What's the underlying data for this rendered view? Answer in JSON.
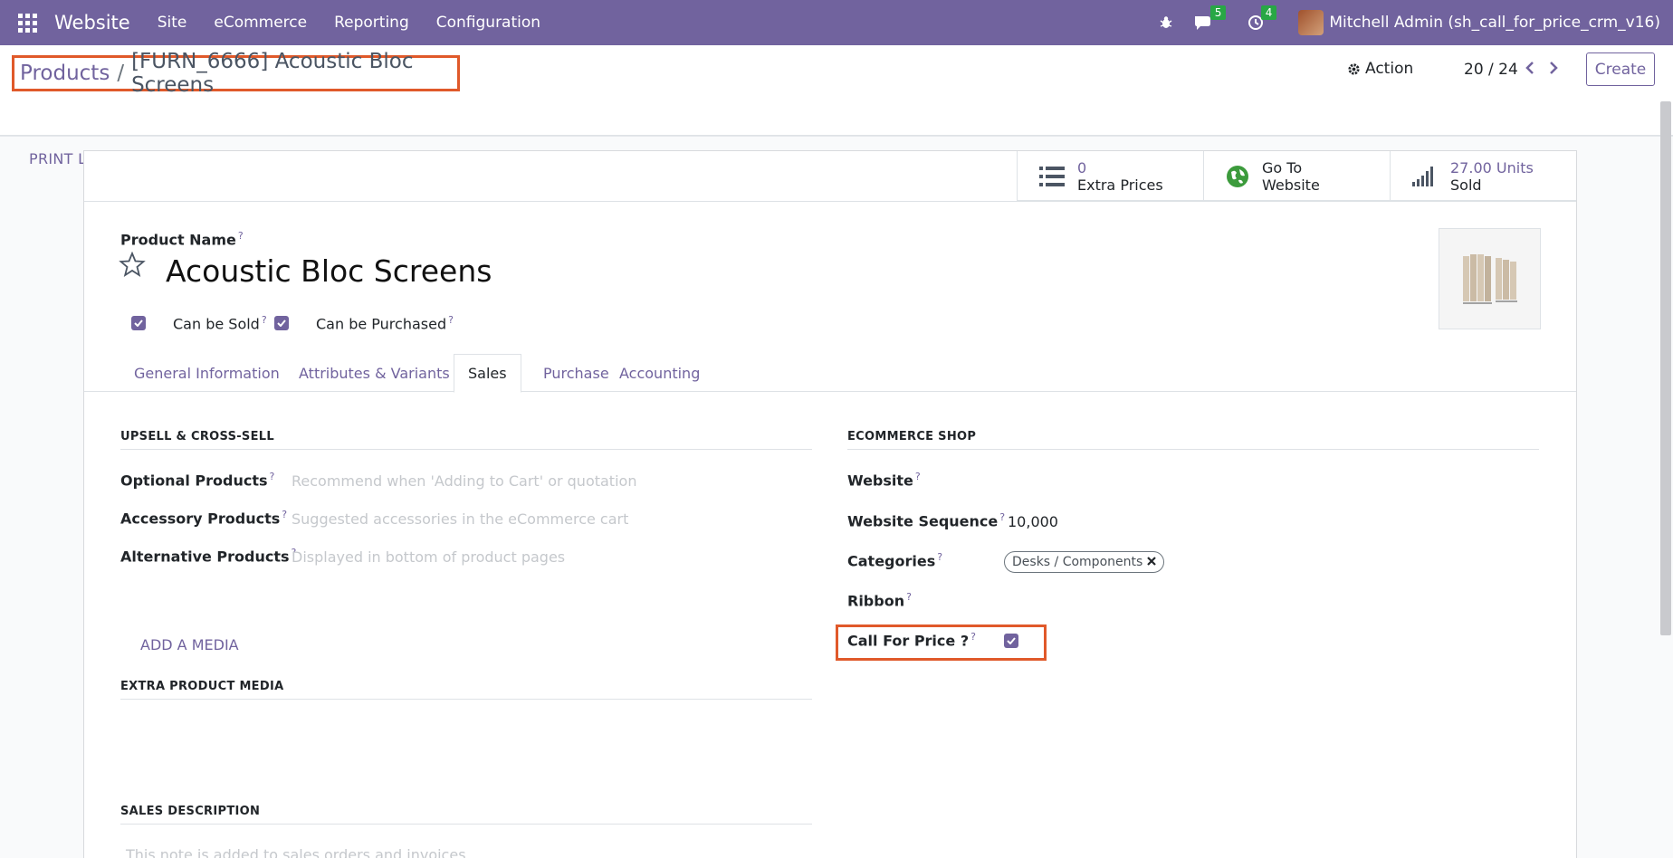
{
  "topnav": {
    "brand": "Website",
    "menus": [
      "Site",
      "eCommerce",
      "Reporting",
      "Configuration"
    ],
    "messages_count": "5",
    "activities_count": "4",
    "user": "Mitchell Admin (sh_call_for_price_crm_v16)"
  },
  "breadcrumb": {
    "parent": "Products",
    "separator": "/",
    "current": "[FURN_6666] Acoustic Bloc Screens"
  },
  "controls": {
    "action": "Action",
    "pager": "20 / 24",
    "create": "Create",
    "print_labels": "PRINT LABELS"
  },
  "stat_buttons": [
    {
      "value": "0",
      "label": "Extra Prices",
      "icon": "list-icon"
    },
    {
      "value": "Go To",
      "label": "Website",
      "icon": "globe-icon"
    },
    {
      "value": "27.00 Units",
      "label": "Sold",
      "icon": "signal-bars-icon"
    }
  ],
  "form": {
    "product_name_label": "Product Name",
    "product_name": "Acoustic Bloc Screens",
    "can_be_sold": "Can be Sold",
    "can_be_purchased": "Can be Purchased",
    "help": "?"
  },
  "tabs": [
    "General Information",
    "Attributes & Variants",
    "Sales",
    "Purchase",
    "Accounting"
  ],
  "active_tab": "Sales",
  "upsell": {
    "title": "UPSELL & CROSS-SELL",
    "fields": [
      {
        "label": "Optional Products",
        "placeholder": "Recommend when 'Adding to Cart' or quotation"
      },
      {
        "label": "Accessory Products",
        "placeholder": "Suggested accessories in the eCommerce cart"
      },
      {
        "label": "Alternative Products",
        "placeholder": "Displayed in bottom of product pages"
      }
    ]
  },
  "ecommerce": {
    "title": "ECOMMERCE SHOP",
    "website_label": "Website",
    "website_sequence_label": "Website Sequence",
    "website_sequence_value": "10,000",
    "categories_label": "Categories",
    "category_tag": "Desks / Components",
    "ribbon_label": "Ribbon",
    "call_for_price_label": "Call For Price ?",
    "call_for_price_checked": true
  },
  "extra_media": {
    "title": "EXTRA PRODUCT MEDIA",
    "add_media": "ADD A MEDIA"
  },
  "sales_description": {
    "title": "SALES DESCRIPTION",
    "placeholder": "This note is added to sales orders and invoices."
  },
  "colors": {
    "brand": "#71639e",
    "highlight": "#e0592a",
    "badge": "#28a745"
  }
}
